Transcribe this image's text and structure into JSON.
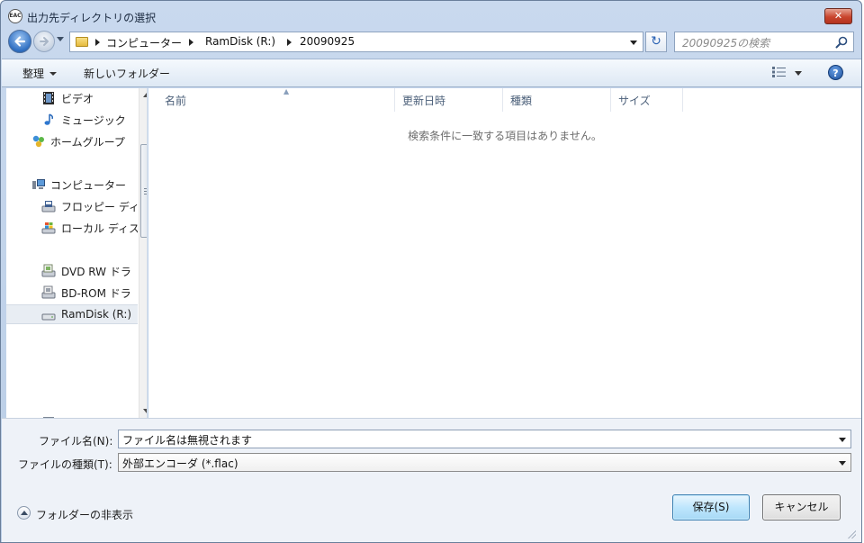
{
  "window": {
    "title": "出力先ディレクトリの選択",
    "app_icon_text": "EAC",
    "close_symbol": "✕"
  },
  "address": {
    "crumbs": [
      "コンピューター",
      "RamDisk (R:)",
      "20090925"
    ],
    "refresh_symbol": "↻"
  },
  "search": {
    "placeholder": "20090925の検索"
  },
  "toolbar": {
    "organize_label": "整理",
    "new_folder_label": "新しいフォルダー",
    "help_label": "?"
  },
  "nav": {
    "items": [
      {
        "label": "ビデオ",
        "icon": "video-icon",
        "selected": false
      },
      {
        "label": "ミュージック",
        "icon": "music-icon",
        "selected": false
      },
      {
        "label": "ホームグループ",
        "icon": "homegroup-icon",
        "selected": false
      },
      {
        "label": "コンピューター",
        "icon": "computer-icon",
        "selected": false
      },
      {
        "label": "フロッピー ディ",
        "icon": "floppy-drive-icon",
        "selected": false
      },
      {
        "label": "ローカル ディス",
        "icon": "local-disk-icon",
        "selected": false
      },
      {
        "label": "DVD RW ドラ",
        "icon": "dvd-drive-icon",
        "selected": false
      },
      {
        "label": "BD-ROM ドラ",
        "icon": "bd-drive-icon",
        "selected": false
      },
      {
        "label": "RamDisk (R:)",
        "icon": "ramdisk-icon",
        "selected": true
      }
    ]
  },
  "content": {
    "columns": [
      "名前",
      "更新日時",
      "種類",
      "サイズ"
    ],
    "empty_message": "検索条件に一致する項目はありません。"
  },
  "form": {
    "filename_label": "ファイル名(N):",
    "filename_value": "ファイル名は無視されます",
    "filetype_label": "ファイルの種類(T):",
    "filetype_value": "外部エンコーダ (*.flac)",
    "hide_folders_label": "フォルダーの非表示",
    "save_label": "保存(S)",
    "cancel_label": "キャンセル"
  },
  "colors": {
    "frame": "#b9cde6",
    "accent_button": "#bee6fd",
    "close_button": "#c9452e",
    "selection": "#e8edf3"
  }
}
